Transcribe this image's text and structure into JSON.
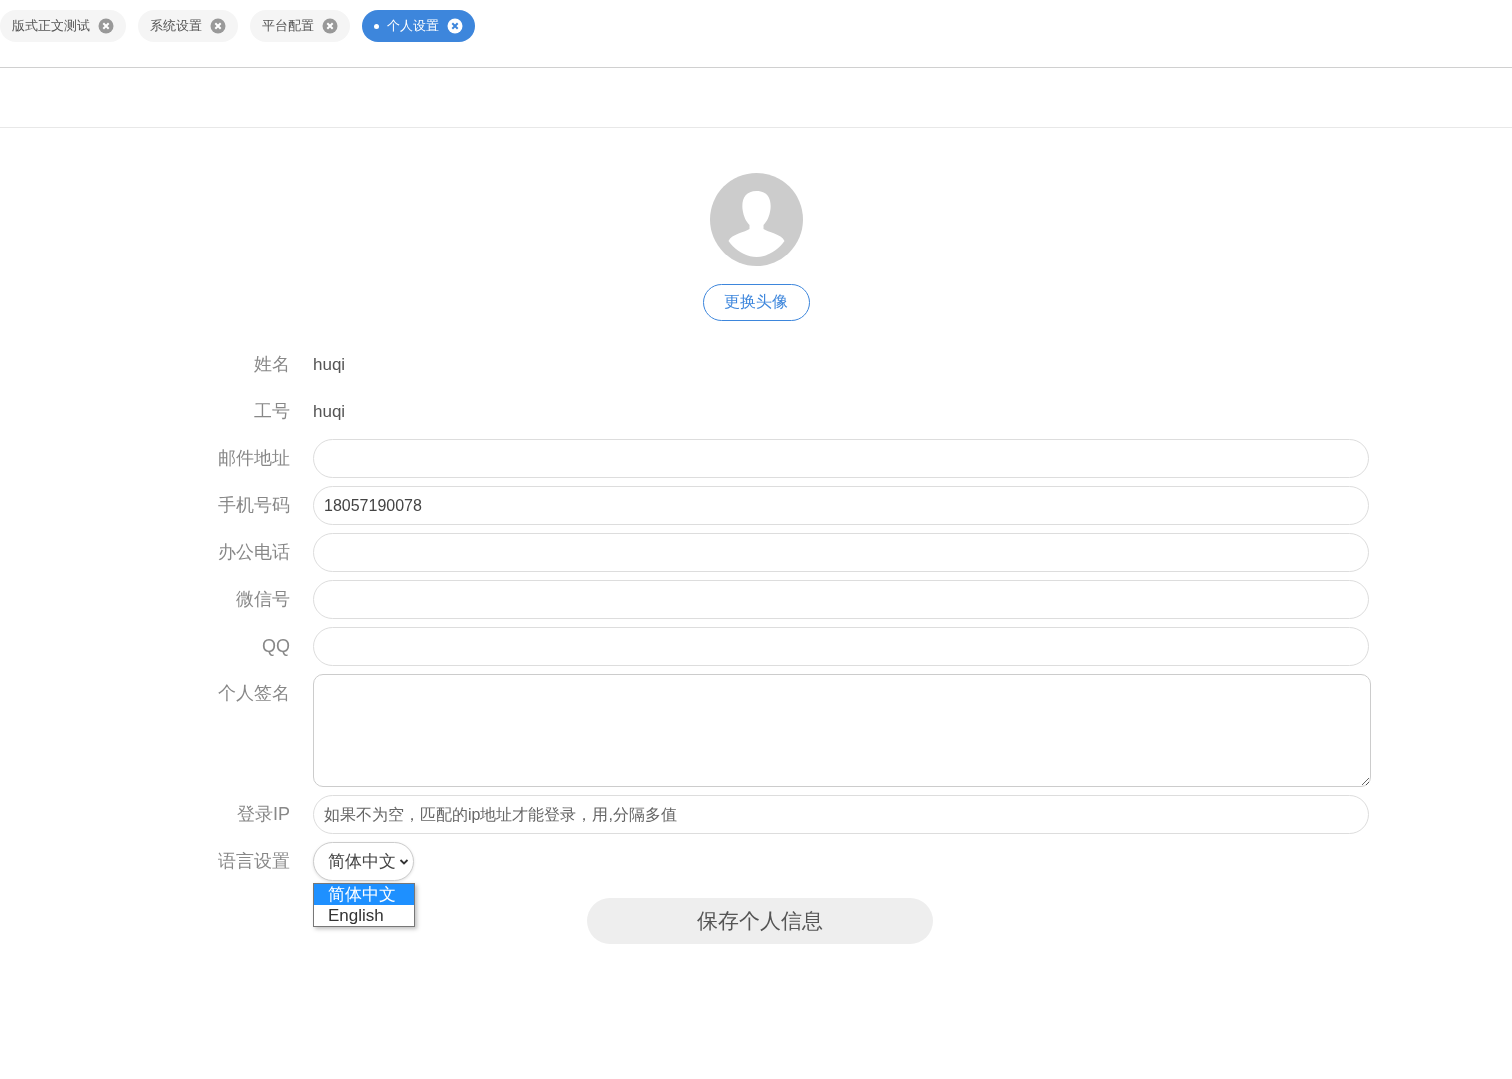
{
  "tabs": [
    {
      "label": "版式正文测试",
      "selected": false
    },
    {
      "label": "系统设置",
      "selected": false
    },
    {
      "label": "平台配置",
      "selected": false
    },
    {
      "label": "个人设置",
      "selected": true
    }
  ],
  "avatar": {
    "button": "更换头像"
  },
  "form": [
    {
      "kind": "text",
      "label": "姓名",
      "value": "huqi"
    },
    {
      "kind": "text",
      "label": "工号",
      "value": "huqi"
    },
    {
      "kind": "input",
      "label": "邮件地址"
    },
    {
      "kind": "input",
      "label": "手机号码",
      "value": "18057190078"
    },
    {
      "kind": "input",
      "label": "办公电话"
    },
    {
      "kind": "input",
      "label": "微信号"
    },
    {
      "kind": "input",
      "label": "QQ"
    },
    {
      "kind": "textarea",
      "label": "个人签名"
    },
    {
      "kind": "input",
      "label": "登录IP",
      "placeholder": "如果不为空，匹配的ip地址才能登录，用,分隔多值"
    },
    {
      "kind": "select",
      "label": "语言设置",
      "value": "简体中文",
      "expanded": true,
      "options": [
        {
          "label": "简体中文",
          "selected": true
        },
        {
          "label": "English",
          "selected": false
        }
      ]
    }
  ],
  "save_button": "保存个人信息"
}
